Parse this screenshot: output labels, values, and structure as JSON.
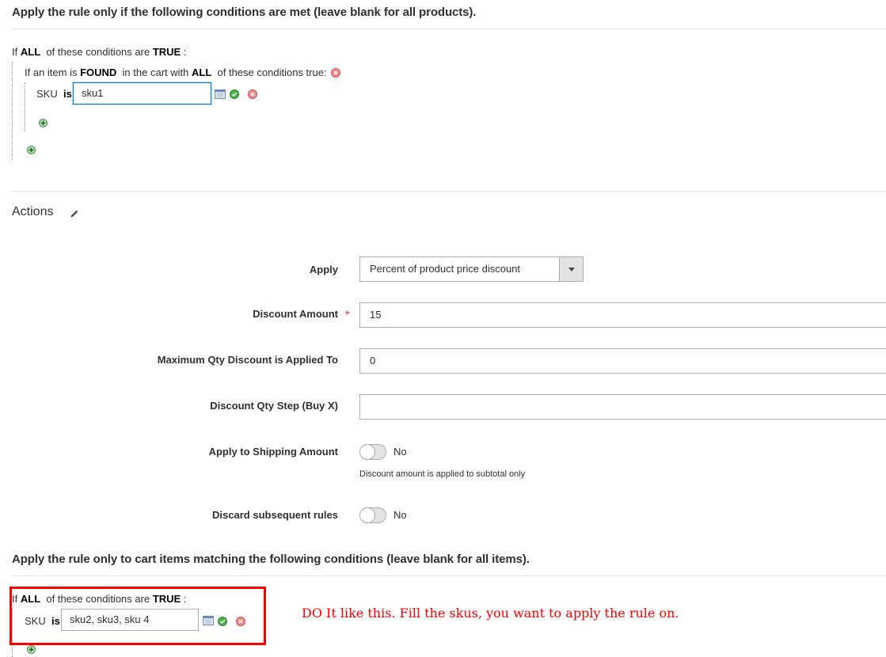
{
  "conditions_section": {
    "title": "Apply the rule only if the following conditions are met (leave blank for all products).",
    "root": {
      "prefix": "If",
      "aggregator": "ALL",
      "middle": "of these conditions are",
      "value": "TRUE",
      "suffix": ":"
    },
    "found": {
      "prefix": "If an item is",
      "found": "FOUND",
      "middle": "in the cart with",
      "aggregator": "ALL",
      "suffix": "of these conditions true:"
    },
    "sku_condition": {
      "attribute": "SKU",
      "operator": "is",
      "value": "sku1"
    }
  },
  "actions_section": {
    "title": "Actions",
    "fields": {
      "apply": {
        "label": "Apply",
        "value": "Percent of product price discount"
      },
      "discount_amount": {
        "label": "Discount Amount",
        "required_mark": "*",
        "value": "15"
      },
      "max_qty": {
        "label": "Maximum Qty Discount is Applied To",
        "value": "0"
      },
      "qty_step": {
        "label": "Discount Qty Step (Buy X)",
        "value": ""
      },
      "apply_shipping": {
        "label": "Apply to Shipping Amount",
        "state": "No",
        "note": "Discount amount is applied to subtotal only"
      },
      "discard_rules": {
        "label": "Discard subsequent rules",
        "state": "No"
      }
    }
  },
  "cart_items_section": {
    "title": "Apply the rule only to cart items matching the following conditions (leave blank for all items).",
    "root": {
      "prefix": "If",
      "aggregator": "ALL",
      "middle": "of these conditions are",
      "value": "TRUE",
      "suffix": ":"
    },
    "sku_condition": {
      "attribute": "SKU",
      "operator": "is",
      "value": "sku2, sku3, sku 4"
    }
  },
  "annotation": {
    "text": "DO It like this. Fill the skus, you want to apply the rule on.",
    "color": "#ff0000"
  }
}
